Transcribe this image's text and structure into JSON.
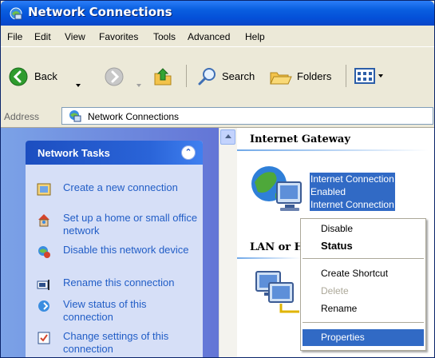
{
  "window": {
    "title": "Network Connections"
  },
  "menu": [
    "File",
    "Edit",
    "View",
    "Favorites",
    "Tools",
    "Advanced",
    "Help"
  ],
  "toolbar": {
    "back": "Back",
    "search": "Search",
    "folders": "Folders"
  },
  "address": {
    "label": "Address",
    "value": "Network Connections"
  },
  "tasks": {
    "header": "Network Tasks",
    "collapse_glyph": "⌃",
    "items": [
      {
        "label": "Create a new connection",
        "icon": "new-connection-icon"
      },
      {
        "label": "Set up a home or small office network",
        "icon": "home-network-icon"
      },
      {
        "label": "Disable this network device",
        "icon": "disable-device-icon"
      },
      {
        "label": "Rename this connection",
        "icon": "rename-icon"
      },
      {
        "label": "View status of this connection",
        "icon": "status-icon"
      },
      {
        "label": "Change settings of this connection",
        "icon": "settings-icon"
      }
    ]
  },
  "main": {
    "groups": [
      {
        "header": "Internet Gateway"
      },
      {
        "header": "LAN or H"
      }
    ],
    "gateway_item": {
      "lines": [
        "Internet Connection",
        "Enabled",
        "Internet Connection"
      ]
    }
  },
  "context_menu": {
    "items": [
      {
        "label": "Disable",
        "state": "normal"
      },
      {
        "label": "Status",
        "state": "default"
      },
      {
        "label": "Create Shortcut",
        "state": "normal"
      },
      {
        "label": "Delete",
        "state": "disabled"
      },
      {
        "label": "Rename",
        "state": "normal"
      },
      {
        "label": "Properties",
        "state": "selected"
      }
    ]
  },
  "colors": {
    "selection": "#316ac5",
    "task_link": "#215dc6",
    "titlebar": "#0a5fe0"
  }
}
